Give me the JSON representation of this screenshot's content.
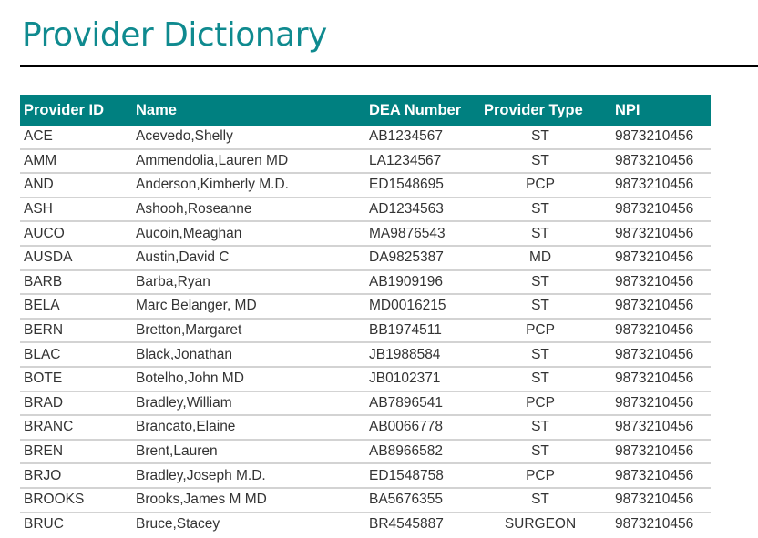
{
  "page": {
    "title": "Provider Dictionary"
  },
  "colors": {
    "title": "#0f8a8f",
    "header_bg": "#008080",
    "header_text": "#ffffff",
    "row_border": "#d3d3d3",
    "body_text": "#333333"
  },
  "table": {
    "columns": [
      "Provider ID",
      "Name",
      "DEA Number",
      "Provider Type",
      "NPI"
    ],
    "rows": [
      [
        "ACE",
        "Acevedo,Shelly",
        "AB1234567",
        "ST",
        "9873210456"
      ],
      [
        "AMM",
        "Ammendolia,Lauren MD",
        "LA1234567",
        "ST",
        "9873210456"
      ],
      [
        "AND",
        "Anderson,Kimberly M.D.",
        "ED1548695",
        "PCP",
        "9873210456"
      ],
      [
        "ASH",
        "Ashooh,Roseanne",
        "AD1234563",
        "ST",
        "9873210456"
      ],
      [
        "AUCO",
        "Aucoin,Meaghan",
        "MA9876543",
        "ST",
        "9873210456"
      ],
      [
        "AUSDA",
        "Austin,David C",
        "DA9825387",
        "MD",
        "9873210456"
      ],
      [
        "BARB",
        "Barba,Ryan",
        "AB1909196",
        "ST",
        "9873210456"
      ],
      [
        "BELA",
        "Marc Belanger, MD",
        "MD0016215",
        "ST",
        "9873210456"
      ],
      [
        "BERN",
        "Bretton,Margaret",
        "BB1974511",
        "PCP",
        "9873210456"
      ],
      [
        "BLAC",
        "Black,Jonathan",
        "JB1988584",
        "ST",
        "9873210456"
      ],
      [
        "BOTE",
        "Botelho,John MD",
        "JB0102371",
        "ST",
        "9873210456"
      ],
      [
        "BRAD",
        "Bradley,William",
        "AB7896541",
        "PCP",
        "9873210456"
      ],
      [
        "BRANC",
        "Brancato,Elaine",
        "AB0066778",
        "ST",
        "9873210456"
      ],
      [
        "BREN",
        "Brent,Lauren",
        "AB8966582",
        "ST",
        "9873210456"
      ],
      [
        "BRJO",
        "Bradley,Joseph M.D.",
        "ED1548758",
        "PCP",
        "9873210456"
      ],
      [
        "BROOKS",
        "Brooks,James M MD",
        "BA5676355",
        "ST",
        "9873210456"
      ],
      [
        "BRUC",
        "Bruce,Stacey",
        "BR4545887",
        "SURGEON",
        "9873210456"
      ]
    ]
  }
}
